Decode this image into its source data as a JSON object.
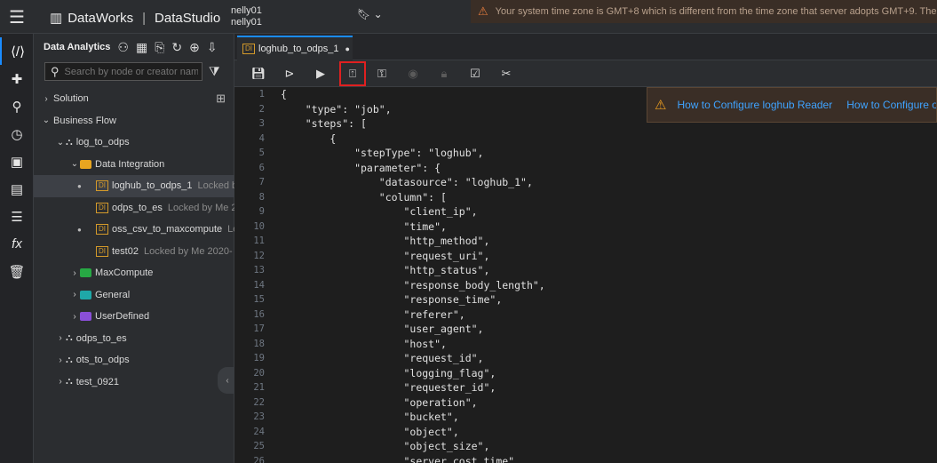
{
  "header": {
    "brand": "DataWorks",
    "app": "DataStudio",
    "user_line1": "nelly01",
    "user_line2": "nelly01",
    "warning": "Your system time zone is GMT+8 which is different from the time zone that server adopts GMT+9. The ti"
  },
  "sidebar": {
    "title": "Data Analytics",
    "search_placeholder": "Search by node or creator name.",
    "solution_label": "Solution",
    "business_flow_label": "Business Flow",
    "tree": [
      {
        "label": "log_to_odps",
        "meta": "",
        "type": "flow"
      },
      {
        "label": "Data Integration",
        "meta": "",
        "type": "folder"
      },
      {
        "label": "loghub_to_odps_1",
        "meta": "Locked by",
        "type": "di"
      },
      {
        "label": "odps_to_es",
        "meta": "Locked by Me  2",
        "type": "di"
      },
      {
        "label": "oss_csv_to_maxcompute",
        "meta": "Lo",
        "type": "di"
      },
      {
        "label": "test02",
        "meta": "Locked by Me  2020-",
        "type": "di"
      },
      {
        "label": "MaxCompute",
        "meta": "",
        "type": "mc"
      },
      {
        "label": "General",
        "meta": "",
        "type": "gen"
      },
      {
        "label": "UserDefined",
        "meta": "",
        "type": "ud"
      },
      {
        "label": "odps_to_es",
        "meta": "",
        "type": "flow"
      },
      {
        "label": "ots_to_odps",
        "meta": "",
        "type": "flow"
      },
      {
        "label": "test_0921",
        "meta": "",
        "type": "flow"
      }
    ]
  },
  "tab": {
    "label": "loghub_to_odps_1",
    "badge": "DI"
  },
  "hints": [
    "How to Configure loghub Reader",
    "How to Configure o"
  ],
  "colors": {
    "accent": "#1a8cff",
    "highlight": "#e02020",
    "di": "#d49a2a"
  },
  "code_lines": [
    "{",
    "    \"type\": \"job\",",
    "    \"steps\": [",
    "        {",
    "            \"stepType\": \"loghub\",",
    "            \"parameter\": {",
    "                \"datasource\": \"loghub_1\",",
    "                \"column\": [",
    "                    \"client_ip\",",
    "                    \"time\",",
    "                    \"http_method\",",
    "                    \"request_uri\",",
    "                    \"http_status\",",
    "                    \"response_body_length\",",
    "                    \"response_time\",",
    "                    \"referer\",",
    "                    \"user_agent\",",
    "                    \"host\",",
    "                    \"request_id\",",
    "                    \"logging_flag\",",
    "                    \"requester_id\",",
    "                    \"operation\",",
    "                    \"bucket\",",
    "                    \"object\",",
    "                    \"object_size\",",
    "                    \"server_cost_time\","
  ]
}
